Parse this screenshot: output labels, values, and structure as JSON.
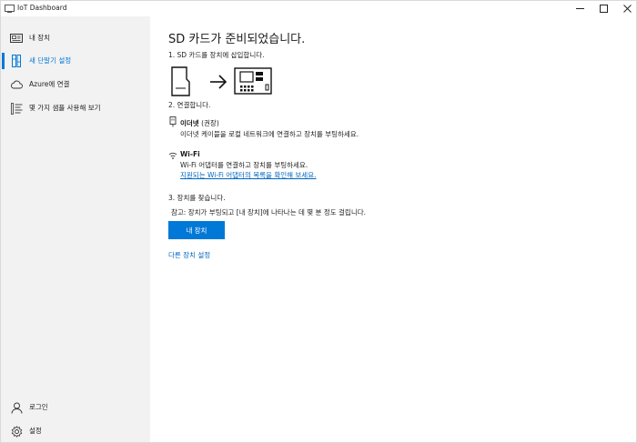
{
  "window": {
    "title": "IoT Dashboard"
  },
  "sidebar": {
    "items": [
      {
        "label": "내 장치",
        "icon": "devices-icon"
      },
      {
        "label": "새 단말기 설정",
        "icon": "board-setup-icon",
        "active": true
      },
      {
        "label": "Azure에 연결",
        "icon": "cloud-icon"
      },
      {
        "label": "몇 가지 샘플 사용해 보기",
        "icon": "samples-list-icon"
      }
    ],
    "bottom_items": [
      {
        "label": "로그인",
        "icon": "person-icon"
      },
      {
        "label": "설정",
        "icon": "gear-icon"
      }
    ]
  },
  "main": {
    "title": "SD 카드가 준비되었습니다.",
    "step1": "1. SD 카드를 장치에 삽입합니다.",
    "step2": "2. 연결합니다.",
    "ethernet": {
      "title": "이더넷",
      "recommended": " (권장)",
      "desc": "이더넷 케이블을 로컬 네트워크에 연결하고 장치를 부팅하세요."
    },
    "wifi": {
      "title": "Wi-Fi",
      "desc": "Wi-Fi 어댑터를 연결하고 장치를 부팅하세요.",
      "link": "지원되는 Wi-Fi 어댑터의 목록을 확인해 보세요."
    },
    "step3": "3. 장치를 찾습니다.",
    "note": "참고: 장치가 부팅되고 [내 장치]에 나타나는 데 몇 분 정도 걸립니다.",
    "my_devices_button": "내 장치",
    "other_device_link": "다른 장치 설정"
  },
  "colors": {
    "accent": "#0078d7",
    "link": "#0067c0",
    "sidebar_bg": "#f2f2f2"
  }
}
